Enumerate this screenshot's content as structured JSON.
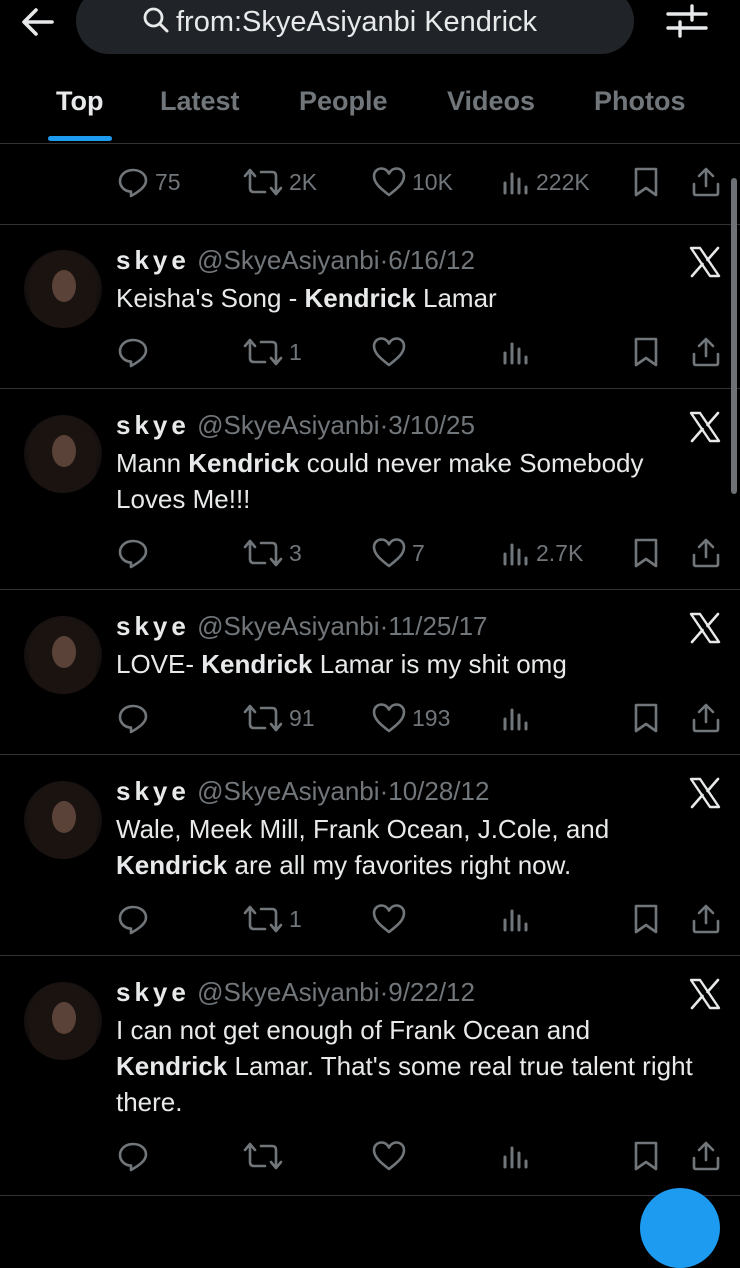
{
  "header": {
    "search_query": "from:SkyeAsiyanbi Kendrick"
  },
  "tabs": [
    {
      "label": "Top",
      "active": true
    },
    {
      "label": "Latest",
      "active": false
    },
    {
      "label": "People",
      "active": false
    },
    {
      "label": "Videos",
      "active": false
    },
    {
      "label": "Photos",
      "active": false
    }
  ],
  "icons": {
    "back": "arrow-left-icon",
    "search": "search-icon",
    "filter": "filter-sliders-icon",
    "reply": "reply-icon",
    "retweet": "retweet-icon",
    "like": "heart-icon",
    "views": "views-chart-icon",
    "bookmark": "bookmark-icon",
    "share": "share-icon",
    "platform": "x-logo-icon"
  },
  "colors": {
    "background": "#000000",
    "text": "#e7e9ea",
    "muted": "#71767b",
    "accent": "#1d9bf0"
  },
  "partial_post": {
    "stats": {
      "replies": "75",
      "reposts": "2K",
      "likes": "10K",
      "views": "222K"
    }
  },
  "posts": [
    {
      "name": "skye",
      "handle": "@SkyeAsiyanbi",
      "separator": "·",
      "date": "6/16/12",
      "text": [
        {
          "t": "Keisha's Song - "
        },
        {
          "t": "Kendrick",
          "b": true
        },
        {
          "t": " Lamar"
        }
      ],
      "stats": {
        "replies": "",
        "reposts": "1",
        "likes": "",
        "views": ""
      }
    },
    {
      "name": "skye",
      "handle": "@SkyeAsiyanbi",
      "separator": "·",
      "date": "3/10/25",
      "text": [
        {
          "t": "Mann "
        },
        {
          "t": "Kendrick",
          "b": true
        },
        {
          "t": " could never make Somebody Loves Me!!!"
        }
      ],
      "stats": {
        "replies": "",
        "reposts": "3",
        "likes": "7",
        "views": "2.7K"
      }
    },
    {
      "name": "skye",
      "handle": "@SkyeAsiyanbi",
      "separator": "·",
      "date": "11/25/17",
      "text": [
        {
          "t": "LOVE- "
        },
        {
          "t": "Kendrick",
          "b": true
        },
        {
          "t": " Lamar is my shit omg"
        }
      ],
      "stats": {
        "replies": "",
        "reposts": "91",
        "likes": "193",
        "views": ""
      }
    },
    {
      "name": "skye",
      "handle": "@SkyeAsiyanbi",
      "separator": "·",
      "date": "10/28/12",
      "text": [
        {
          "t": "Wale, Meek Mill, Frank Ocean, J.Cole, and "
        },
        {
          "t": "Kendrick",
          "b": true
        },
        {
          "t": " are all my favorites right now."
        }
      ],
      "stats": {
        "replies": "",
        "reposts": "1",
        "likes": "",
        "views": ""
      }
    },
    {
      "name": "skye",
      "handle": "@SkyeAsiyanbi",
      "separator": "·",
      "date": "9/22/12",
      "text": [
        {
          "t": "I can not get enough of Frank Ocean and "
        },
        {
          "t": "Kendrick",
          "b": true
        },
        {
          "t": " Lamar. That's some real true talent right there."
        }
      ],
      "stats": {
        "replies": "",
        "reposts": "",
        "likes": "",
        "views": ""
      }
    }
  ]
}
